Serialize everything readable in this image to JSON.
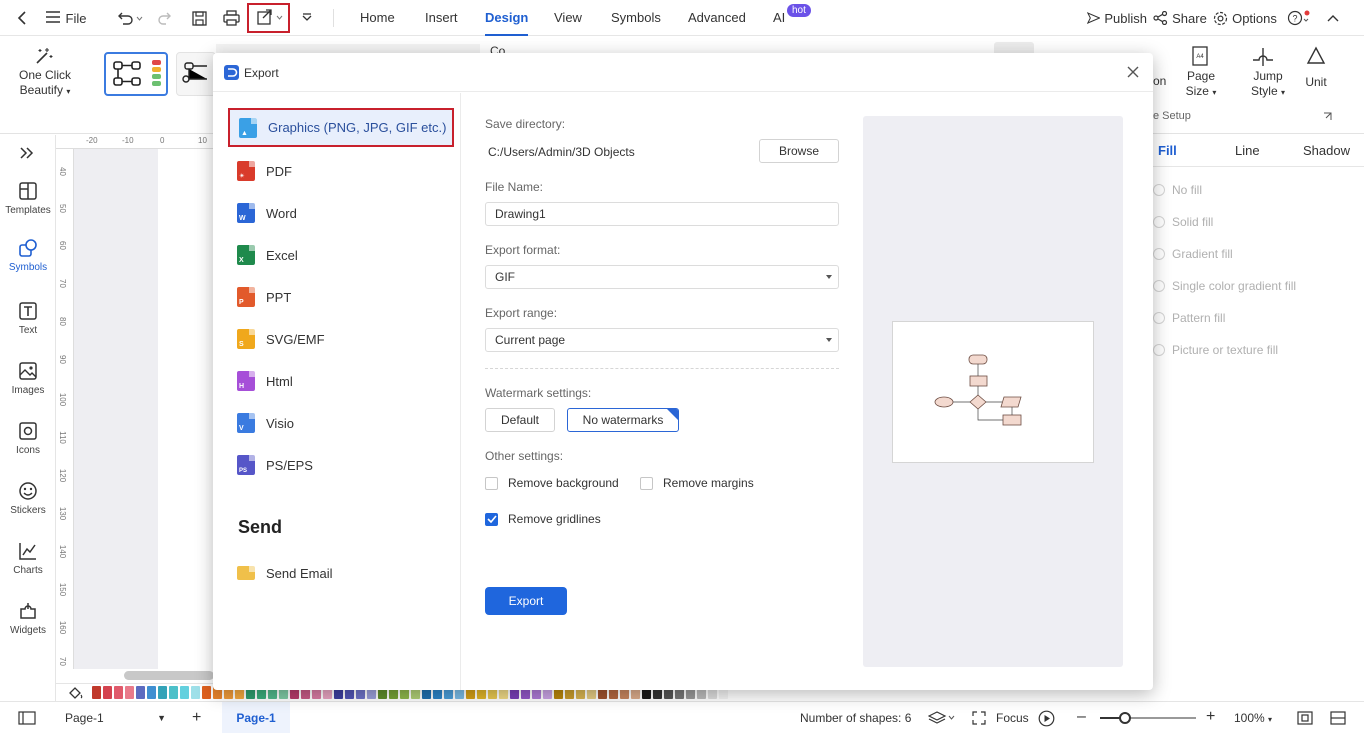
{
  "topbar": {
    "file_label": "File",
    "menu": [
      "Home",
      "Insert",
      "Design",
      "View",
      "Symbols",
      "Advanced",
      "AI"
    ],
    "active_menu": "Design",
    "hot_badge": "hot",
    "publish_label": "Publish",
    "share_label": "Share",
    "options_label": "Options",
    "help_label": "?"
  },
  "ribbon": {
    "one_click_label": "One Click",
    "beautify_label": "Beautify",
    "page_size": [
      "Page",
      "Size"
    ],
    "jump_style": [
      "Jump",
      "Style"
    ],
    "unit_label": "Unit",
    "cut_text_1": "on",
    "cut_text_2": "e Setup",
    "cut_text_3": "Co"
  },
  "rail": {
    "items": [
      "Templates",
      "Symbols",
      "Text",
      "Images",
      "Icons",
      "Stickers",
      "Charts",
      "Widgets"
    ],
    "active": "Symbols"
  },
  "ruler": {
    "top": [
      "-20",
      "-10",
      "0",
      "10"
    ],
    "left": [
      "40",
      "50",
      "60",
      "70",
      "80",
      "90",
      "100",
      "110",
      "120",
      "130",
      "140",
      "150",
      "160",
      "70"
    ]
  },
  "right_panel": {
    "tabs": [
      "Fill",
      "Line",
      "Shadow"
    ],
    "active_tab": "Fill",
    "options": [
      "No fill",
      "Solid fill",
      "Gradient fill",
      "Single color gradient fill",
      "Pattern fill",
      "Picture or texture fill"
    ]
  },
  "colors": {
    "accent": "#1f5fd1",
    "highlight_border": "#c8202c",
    "swatches": [
      "#c0392b",
      "#d4434f",
      "#e05a6b",
      "#e97a8a",
      "#5c6bc0",
      "#3f8fd1",
      "#33a3b8",
      "#4cc0c9",
      "#63d0de",
      "#9ee0e9",
      "#e0611f",
      "#e8842c",
      "#f09b3a",
      "#f4a940",
      "#2f9e6f",
      "#3aad7c",
      "#52b98c",
      "#7fcba5",
      "#b83b6c",
      "#c75a86",
      "#d97ba3",
      "#e7a3c0",
      "#3d3f9f",
      "#5156b5",
      "#6d73c7",
      "#9aa0da",
      "#5e8d2a",
      "#76a236",
      "#8fb84c",
      "#b0cf75",
      "#1e6fb0",
      "#2c84c7",
      "#4a9dd8",
      "#79bbe6",
      "#d4a017",
      "#e0b52a",
      "#e8c84f",
      "#f0da86",
      "#7a3fb8",
      "#9257c7",
      "#ad7ad6",
      "#c9a3e4",
      "#b8860b",
      "#c99c2c",
      "#d8b451",
      "#e4cb83",
      "#a0522d",
      "#b4673f",
      "#c8865e",
      "#dcac8b",
      "#1a1a1a",
      "#333333",
      "#555555",
      "#777777",
      "#999999",
      "#bbbbbb",
      "#dddddd",
      "#f3f3f3"
    ]
  },
  "status": {
    "page_select": "Page-1",
    "page_tab": "Page-1",
    "shapes_label": "Number of shapes: 6",
    "focus_label": "Focus",
    "zoom": "100%"
  },
  "dialog": {
    "title": "Export",
    "formats": [
      "Graphics (PNG, JPG, GIF etc.)",
      "PDF",
      "Word",
      "Excel",
      "PPT",
      "SVG/EMF",
      "Html",
      "Visio",
      "PS/EPS"
    ],
    "selected_format": "Graphics (PNG, JPG, GIF etc.)",
    "format_icons": [
      {
        "letter": "",
        "color": "#3aa0e6"
      },
      {
        "letter": "",
        "color": "#d93b2b"
      },
      {
        "letter": "W",
        "color": "#2b66d6"
      },
      {
        "letter": "X",
        "color": "#1f8a4c"
      },
      {
        "letter": "P",
        "color": "#e25a2b"
      },
      {
        "letter": "S",
        "color": "#f0a81c"
      },
      {
        "letter": "H",
        "color": "#a64fd8"
      },
      {
        "letter": "V",
        "color": "#3a7be0"
      },
      {
        "letter": "PS",
        "color": "#5656c8"
      }
    ],
    "send_heading": "Send",
    "send_email": "Send Email",
    "save_dir_label": "Save directory:",
    "save_dir_value": "C:/Users/Admin/3D Objects",
    "browse_label": "Browse",
    "file_name_label": "File Name:",
    "file_name_value": "Drawing1",
    "export_format_label": "Export format:",
    "export_format_value": "GIF",
    "export_range_label": "Export range:",
    "export_range_value": "Current page",
    "watermark_label": "Watermark settings:",
    "watermark_default": "Default",
    "watermark_none": "No watermarks",
    "other_label": "Other settings:",
    "remove_background": {
      "label": "Remove background",
      "checked": false
    },
    "remove_margins": {
      "label": "Remove margins",
      "checked": false
    },
    "remove_gridlines": {
      "label": "Remove gridlines",
      "checked": true
    },
    "export_button": "Export"
  }
}
